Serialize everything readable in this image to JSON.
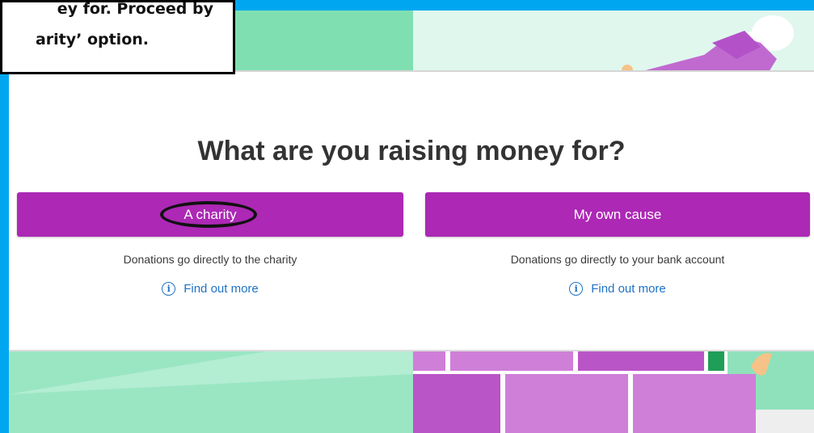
{
  "instruction": {
    "line1": "ey for. Proceed by",
    "line2": "arity’ option."
  },
  "page": {
    "heading": "What are you raising money for?"
  },
  "options": {
    "charity": {
      "button_label": "A charity",
      "description": "Donations go directly to the charity",
      "link_label": "Find out more",
      "highlighted": true
    },
    "own_cause": {
      "button_label": "My own cause",
      "description": "Donations go directly to your bank account",
      "link_label": "Find out more"
    }
  },
  "icons": {
    "info": "info-circle-icon"
  },
  "colors": {
    "frame": "#00a7f0",
    "button": "#ac28b5",
    "link": "#1f72c4",
    "highlight_ring": "#111111"
  }
}
